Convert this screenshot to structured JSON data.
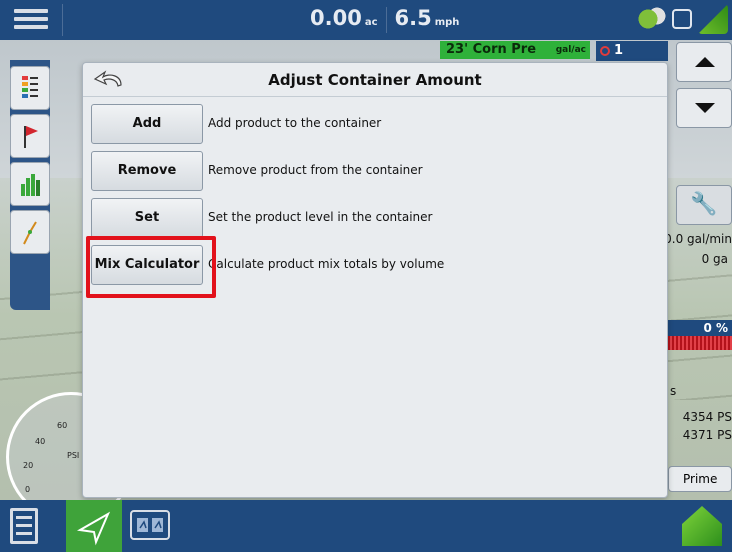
{
  "topbar": {
    "area_value": "0.00",
    "area_unit": "ac",
    "speed_value": "6.5",
    "speed_unit": "mph"
  },
  "product": {
    "name": "23' Corn Pre",
    "rate_unit": "gal/ac"
  },
  "alarm": {
    "count": "1"
  },
  "right_panel": {
    "rate_text": "0.0 gal/min",
    "volume_text": "0 ga",
    "percent_text": "0 %",
    "psi_1": "4354 PS",
    "psi_2": "4371 PS",
    "prime_label": "Prime",
    "small_s": "s"
  },
  "gauge": {
    "ticks": [
      "60",
      "40",
      "20",
      "0"
    ],
    "unit": "PSI"
  },
  "dialog": {
    "title": "Adjust Container Amount",
    "actions": [
      {
        "label": "Add",
        "description": "Add product to the container"
      },
      {
        "label": "Remove",
        "description": "Remove product from the container"
      },
      {
        "label": "Set",
        "description": "Set the product level in the container"
      },
      {
        "label": "Mix Calculator",
        "description": "Calculate product mix totals by volume"
      }
    ]
  },
  "colors": {
    "header_blue": "#1f4a7e",
    "product_green": "#2fb13a",
    "highlight_red": "#e2111b"
  },
  "icons": [
    "menu-icon",
    "back-arrow-icon",
    "wrench-icon",
    "up-arrow-icon",
    "down-arrow-icon",
    "document-icon",
    "navigation-icon",
    "map-view-icon",
    "home-icon",
    "gps-icon"
  ]
}
